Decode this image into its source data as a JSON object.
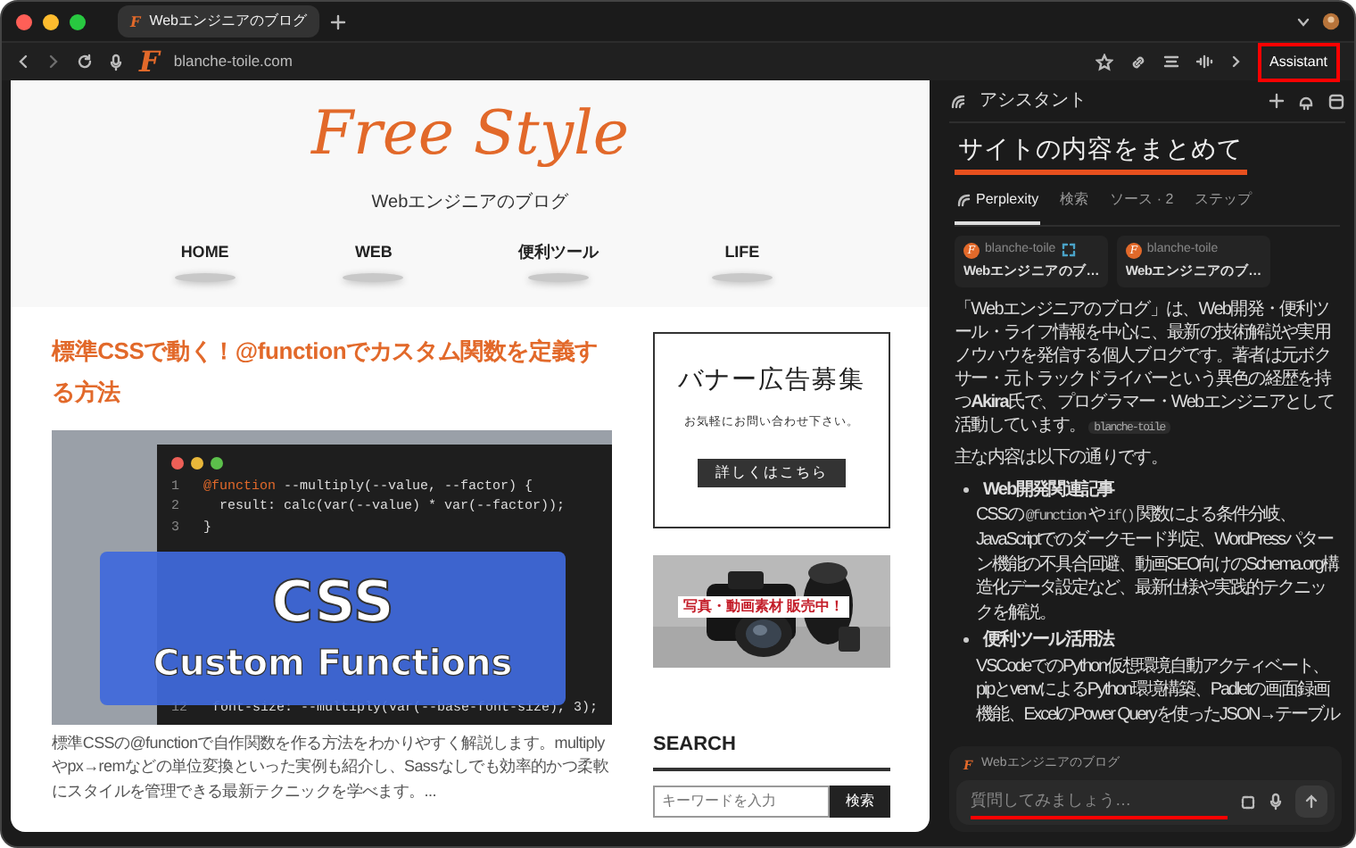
{
  "browser": {
    "tab": {
      "logo": "F",
      "title": "Webエンジニアのブログ",
      "selected": true
    },
    "address": {
      "logo": "F",
      "url": "blanche-toile.com"
    },
    "assistant_button": {
      "label": "Assistant",
      "highlighted": true
    }
  },
  "page": {
    "site_title": "Free Style",
    "tagline": "Webエンジニアのブログ",
    "nav": [
      "HOME",
      "WEB",
      "便利ツール",
      "LIFE"
    ],
    "article": {
      "title": "標準CSSで動く！@functionでカスタム関数を定義する方法",
      "thumbnail": {
        "code_lines": [
          {
            "number": "1",
            "keyword": "@function",
            "code": " --multiply(--value, --factor) {"
          },
          {
            "number": "2",
            "code": "  result: calc(var(--value) * var(--factor));"
          },
          {
            "number": "3",
            "code": "}"
          },
          {
            "number": "12",
            "code": "  font-size: --multiply(var(--base-font-size), 3);"
          }
        ],
        "overlay_title": "CSS",
        "overlay_subtitle": "Custom Functions"
      },
      "excerpt": "標準CSSの@functionで自作関数を作る方法をわかりやすく解説します。multiplyやpx→remなどの単位変換といった実例も紹介し、Sassなしでも効率的かつ柔軟にスタイルを管理できる最新テクニックを学べます。..."
    },
    "banner_ad": {
      "title": "バナー広告募集",
      "text": "お気軽にお問い合わせ下さい。",
      "button": "詳しくはこちら"
    },
    "photo_ad": {
      "kind": "picture",
      "caption": "写真・動画素材 販売中！"
    },
    "search": {
      "heading": "SEARCH",
      "placeholder": "キーワードを入力",
      "button": "検索"
    }
  },
  "assistant": {
    "title": "アシスタント",
    "query": "サイトの内容をまとめて",
    "query_underlined": true,
    "tabs": [
      {
        "label": "Perplexity",
        "selected": true
      },
      {
        "label": "検索",
        "selected": false
      },
      {
        "label": "ソース · 2",
        "selected": false
      },
      {
        "label": "ステップ",
        "selected": false
      }
    ],
    "sources": [
      {
        "logo": "F",
        "site": "blanche-toile",
        "title": "Webエンジニアのブ…",
        "expand_icon": true
      },
      {
        "logo": "F",
        "site": "blanche-toile",
        "title": "Webエンジニアのブ…",
        "expand_icon": false
      }
    ],
    "answer": {
      "paragraph": "「Webエンジニアのブログ」は、Web開発・便利ツール・ライフ情報を中心に、最新の技術解説や実用ノウハウを発信する個人ブログです。著者は元ボクサー・元トラックドライバーという異色の経歴を持つ**Akira**氏で、プログラマー・Webエンジニアとして活動しています。",
      "source_chip": "blanche-toile",
      "intro": "主な内容は以下の通りです。",
      "bullets": [
        {
          "title": "Web開発関連記事",
          "body": [
            {
              "kind": "text",
              "text": "CSSの"
            },
            {
              "kind": "code",
              "text": "@function"
            },
            {
              "kind": "text",
              "text": "や"
            },
            {
              "kind": "code",
              "text": "if()"
            },
            {
              "kind": "text",
              "text": "関数による条件分岐、JavaScriptでのダークモード判定、WordPressパターン機能の不具合回避、動画SEO向けのSchema.org構造化データ設定など、最新仕様や実践的テクニックを解説。"
            }
          ]
        },
        {
          "title": "便利ツール活用法",
          "body": [
            {
              "kind": "text",
              "text": "VSCodeでのPython仮想環境自動アクティベート、pipとvenvによるPython環境構築、Padletの画面録画機能、ExcelのPower Queryを使ったJSON→テーブル"
            }
          ]
        }
      ]
    },
    "context": {
      "logo": "F",
      "label": "Webエンジニアのブログ"
    },
    "input": {
      "placeholder": "質問してみましょう…",
      "underlined": true
    }
  }
}
